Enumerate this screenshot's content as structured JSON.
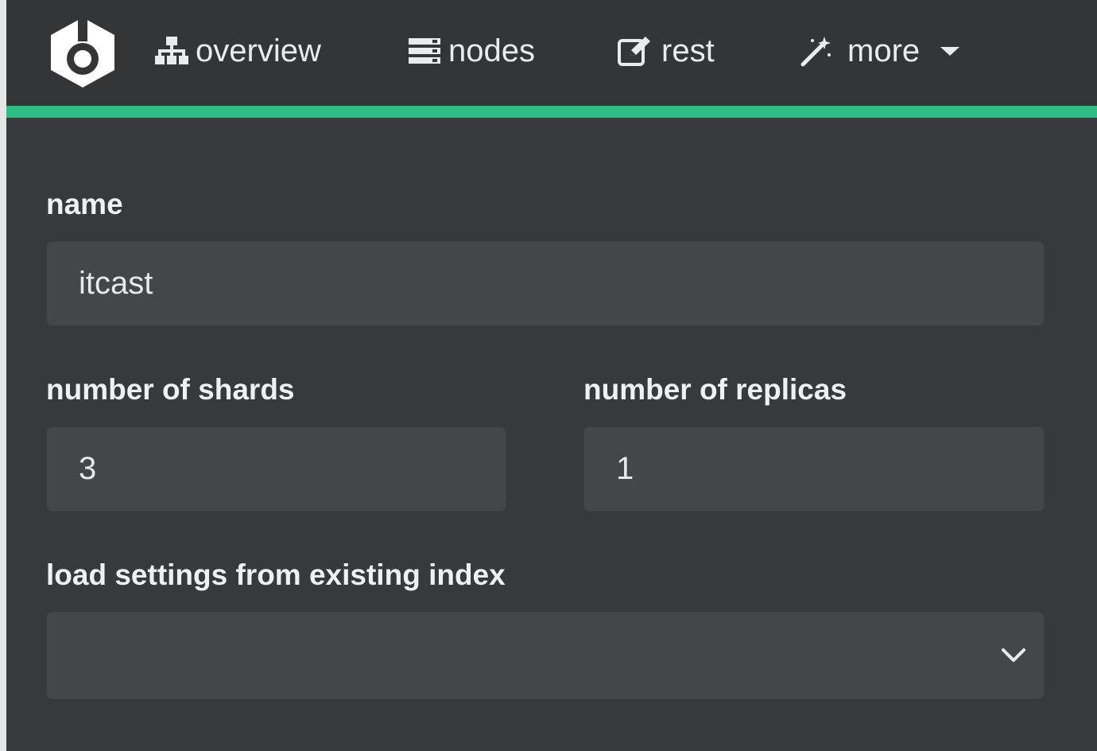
{
  "nav": {
    "logo_icon": "cerebro-logo-icon",
    "items": [
      {
        "label": "overview",
        "icon": "sitemap-icon"
      },
      {
        "label": "nodes",
        "icon": "server-icon"
      },
      {
        "label": "rest",
        "icon": "edit-icon"
      },
      {
        "label": "more",
        "icon": "magic-wand-icon",
        "dropdown": true
      }
    ]
  },
  "form": {
    "name": {
      "label": "name",
      "value": "itcast"
    },
    "shards": {
      "label": "number of shards",
      "value": "3"
    },
    "replicas": {
      "label": "number of replicas",
      "value": "1"
    },
    "load_settings": {
      "label": "load settings from existing index",
      "selected": ""
    }
  },
  "colors": {
    "background": "#37393d",
    "navbar": "#333537",
    "accent": "#2ebd85",
    "input": "#44474a",
    "text": "#eef0f2"
  }
}
